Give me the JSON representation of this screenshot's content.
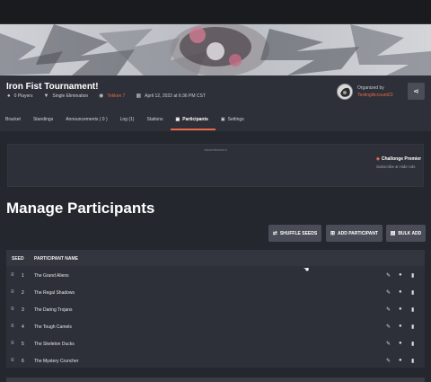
{
  "tournament": {
    "title": "Iron Fist Tournament!",
    "players": "0 Players",
    "format": "Single Elimination",
    "tekken": "Tekken 7",
    "datetime": "April 12, 2022 at 6:36 PM CST",
    "organized_by_label": "Organized by",
    "organizer": "TestingAccount23"
  },
  "tabs": [
    {
      "label": "Bracket"
    },
    {
      "label": "Standings"
    },
    {
      "label": "Announcements ( 0 )"
    },
    {
      "label": "Log (1)"
    },
    {
      "label": "Stations"
    },
    {
      "label": "Participants"
    },
    {
      "label": "Settings"
    }
  ],
  "ad": {
    "label": "Advertisement",
    "premium": "Challonge Premier",
    "hide": "Subscribe & Hide Ads"
  },
  "page": {
    "title": "Manage Participants"
  },
  "buttons": {
    "shuffle": "SHUFFLE SEEDS",
    "add": "ADD PARTICIPANT",
    "bulk": "BULK ADD"
  },
  "table": {
    "headers": {
      "seed": "SEED",
      "name": "PARTICIPANT NAME"
    },
    "rows": [
      {
        "seed": "1",
        "name": "The Grand Aliens"
      },
      {
        "seed": "2",
        "name": "The Regal Shadows"
      },
      {
        "seed": "3",
        "name": "The Daring Trojans"
      },
      {
        "seed": "4",
        "name": "The Tough Camels"
      },
      {
        "seed": "5",
        "name": "The Skeleton Ducks"
      },
      {
        "seed": "6",
        "name": "The Mystery Cruncher"
      }
    ]
  },
  "colors": {
    "accent": "#e8694a",
    "background": "#24272e",
    "panel": "#2d3038",
    "button": "#4a4d57"
  },
  "icons": {
    "players": "user-icon",
    "format": "trophy-icon",
    "game": "eye-icon",
    "date": "calendar-icon",
    "share": "share-icon",
    "lock": "lock-icon",
    "shuffle": "shuffle-icon",
    "add": "plus-square-icon",
    "bulk": "file-icon",
    "drag": "drag-handle-icon",
    "edit": "pencil-icon",
    "user": "user-icon",
    "delete": "trash-icon"
  }
}
